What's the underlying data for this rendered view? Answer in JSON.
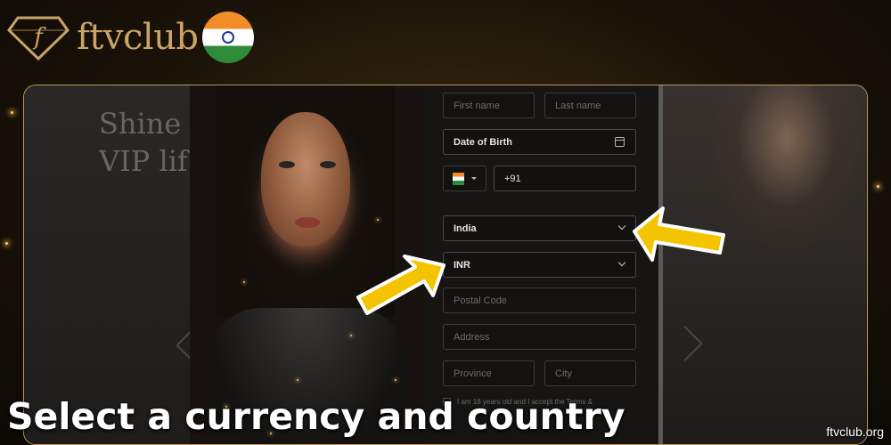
{
  "brand": {
    "name": "ftvclub",
    "logo_letter": "f",
    "accent": "#c8a468",
    "flag_icon": "india-flag-icon"
  },
  "background": {
    "slogan_line1": "Shine",
    "slogan_line2": "VIP lif"
  },
  "form": {
    "first_name_placeholder": "First name",
    "last_name_placeholder": "Last name",
    "dob_label": "Date of Birth",
    "phone_code": "+91",
    "country_value": "India",
    "currency_value": "INR",
    "postal_code_placeholder": "Postal Code",
    "address_placeholder": "Address",
    "province_placeholder": "Province",
    "city_placeholder": "City",
    "terms_text": "I am 18 years old and I accept the Terms &"
  },
  "arrows": {
    "color": "#f5c400",
    "count": 2
  },
  "caption": "Select a currency and country",
  "watermark": "ftvclub.org"
}
